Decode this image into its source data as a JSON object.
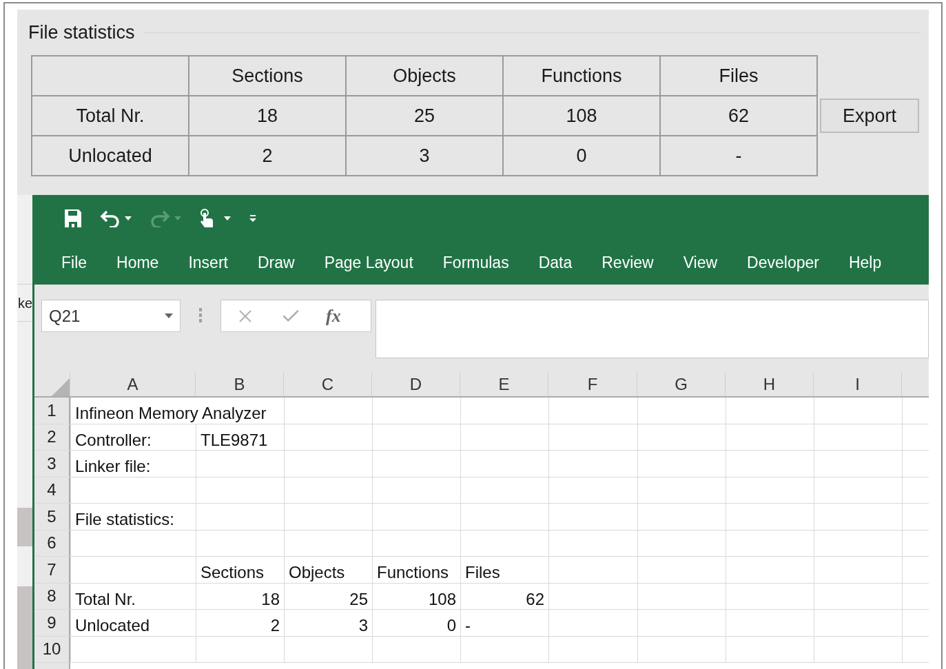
{
  "statistics_panel": {
    "title": "File statistics",
    "columns": [
      "",
      "Sections",
      "Objects",
      "Functions",
      "Files"
    ],
    "rows": [
      {
        "label": "Total Nr.",
        "values": [
          "18",
          "25",
          "108",
          "62"
        ]
      },
      {
        "label": "Unlocated",
        "values": [
          "2",
          "3",
          "0",
          "-"
        ]
      }
    ],
    "export_button": "Export"
  },
  "background_window": {
    "partial_text": "ke"
  },
  "excel": {
    "quick_access": [
      {
        "kind": "save",
        "disabled": false
      },
      {
        "kind": "undo",
        "disabled": false
      },
      {
        "kind": "redo",
        "disabled": true
      },
      {
        "kind": "touch",
        "disabled": false
      },
      {
        "kind": "customize",
        "disabled": false
      }
    ],
    "tabs": [
      "File",
      "Home",
      "Insert",
      "Draw",
      "Page Layout",
      "Formulas",
      "Data",
      "Review",
      "View",
      "Developer",
      "Help"
    ],
    "name_box": "Q21",
    "function_label": "fx",
    "columns": [
      "A",
      "B",
      "C",
      "D",
      "E",
      "F",
      "G",
      "H",
      "I"
    ],
    "rows": [
      {
        "number": "1",
        "cells": [
          {
            "kind": "text",
            "text": "Infineon Memory Analyzer"
          }
        ]
      },
      {
        "number": "2",
        "cells": [
          {
            "kind": "text",
            "text": "Controller:"
          },
          {
            "kind": "text",
            "text": "TLE9871"
          }
        ]
      },
      {
        "number": "3",
        "cells": [
          {
            "kind": "text",
            "text": "Linker file:"
          }
        ]
      },
      {
        "number": "4",
        "cells": []
      },
      {
        "number": "5",
        "cells": [
          {
            "kind": "text",
            "text": "File statistics:"
          }
        ]
      },
      {
        "number": "6",
        "cells": []
      },
      {
        "number": "7",
        "cells": [
          {
            "text": ""
          },
          {
            "kind": "text",
            "text": "Sections"
          },
          {
            "kind": "text",
            "text": "Objects"
          },
          {
            "kind": "text",
            "text": "Functions"
          },
          {
            "kind": "text",
            "text": "Files"
          }
        ]
      },
      {
        "number": "8",
        "cells": [
          {
            "kind": "text",
            "text": "Total Nr."
          },
          {
            "kind": "number",
            "text": "18"
          },
          {
            "kind": "number",
            "text": "25"
          },
          {
            "kind": "number",
            "text": "108"
          },
          {
            "kind": "number",
            "text": "62"
          }
        ]
      },
      {
        "number": "9",
        "cells": [
          {
            "kind": "text",
            "text": "Unlocated"
          },
          {
            "kind": "number",
            "text": "2"
          },
          {
            "kind": "number",
            "text": "3"
          },
          {
            "kind": "number",
            "text": "0"
          },
          {
            "kind": "text",
            "text": "-"
          }
        ]
      },
      {
        "number": "10",
        "cells": []
      }
    ]
  }
}
